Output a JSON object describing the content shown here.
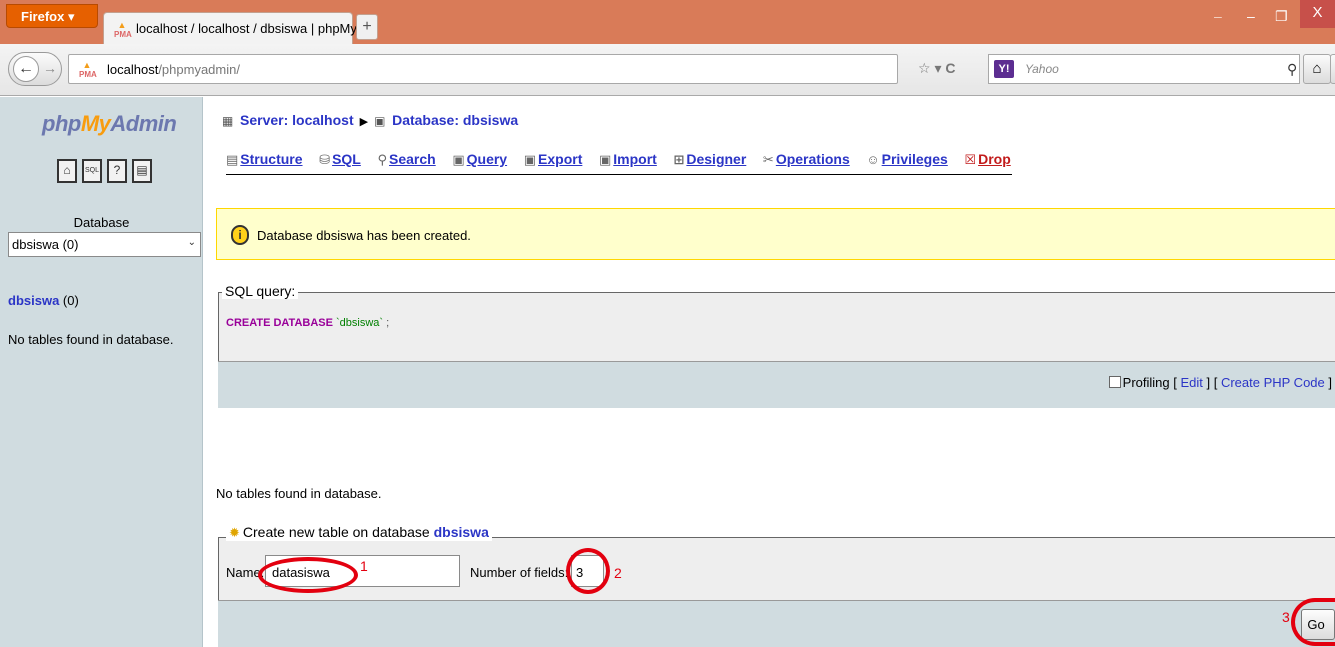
{
  "browser": {
    "app_button": "Firefox ▾",
    "tab_title": "localhost / localhost / dbsiswa | phpMy...",
    "new_tab": "+",
    "url_host": "localhost",
    "url_path": "/phpmyadmin/",
    "search_placeholder": "Yahoo",
    "minimize": "–",
    "maximize": "❐",
    "close": "X",
    "back_icon": "←",
    "forward_icon": "→",
    "home_icon": "⌂"
  },
  "left": {
    "logo_php": "php",
    "logo_my": "My",
    "logo_admin": "Admin",
    "icons": [
      "home-icon",
      "sql-icon",
      "help-icon",
      "docs-icon"
    ],
    "database_label": "Database",
    "database_selected": "dbsiswa (0)",
    "db_link": "dbsiswa",
    "db_count": "(0)",
    "no_tables": "No tables found in database."
  },
  "breadcrumb": {
    "server": "Server: localhost",
    "database": "Database: dbsiswa"
  },
  "tabs": [
    {
      "label": "Structure",
      "icon": "structure-icon"
    },
    {
      "label": "SQL",
      "icon": "sql-icon"
    },
    {
      "label": "Search",
      "icon": "search-icon"
    },
    {
      "label": "Query",
      "icon": "query-icon"
    },
    {
      "label": "Export",
      "icon": "export-icon"
    },
    {
      "label": "Import",
      "icon": "import-icon"
    },
    {
      "label": "Designer",
      "icon": "designer-icon"
    },
    {
      "label": "Operations",
      "icon": "operations-icon"
    },
    {
      "label": "Privileges",
      "icon": "privileges-icon"
    },
    {
      "label": "Drop",
      "icon": "drop-icon"
    }
  ],
  "notice": {
    "text": "Database dbsiswa has been created."
  },
  "sql_query": {
    "legend": "SQL query:",
    "keyword": "CREATE DATABASE",
    "name": "`dbsiswa`",
    "terminator": " ;",
    "profiling": "Profiling",
    "edit": "Edit",
    "create_php": "Create PHP Code"
  },
  "no_tables_main": "No tables found in database.",
  "create_table": {
    "legend": "Create new table on database",
    "db": "dbsiswa",
    "name_label": "Name:",
    "name_value": "datasiswa",
    "fields_label": "Number of fields:",
    "fields_value": "3",
    "go": "Go"
  },
  "annotations": [
    "1",
    "2",
    "3"
  ],
  "colors": {
    "titlebar": "#d97b58",
    "left_frame": "#d0dce0",
    "link": "#2b35c6",
    "notice_bg": "#ffffcc",
    "annotation": "#e3000f"
  }
}
